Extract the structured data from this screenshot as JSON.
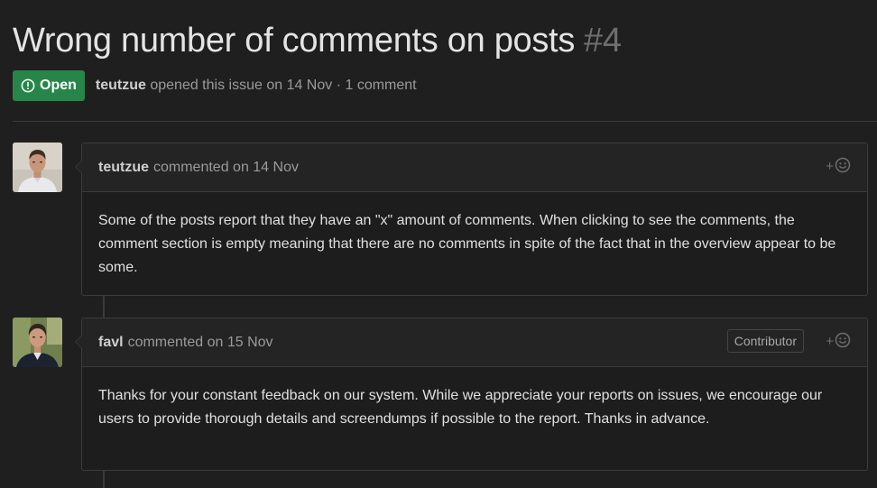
{
  "issue": {
    "title": "Wrong number of comments on posts",
    "number": "#4",
    "state": "Open",
    "author": "teutzue",
    "meta": "opened this issue on 14 Nov · 1 comment"
  },
  "comments": [
    {
      "author": "teutzue",
      "action": "commented on 14 Nov",
      "role_badge": "",
      "body": "Some of the posts report that they have an \"x\" amount of comments. When clicking to see the comments, the comment section is empty meaning that there are no comments in spite of the fact that in the overview appear to be some."
    },
    {
      "author": "favl",
      "action": "commented on 15 Nov",
      "role_badge": "Contributor",
      "body": "Thanks for your constant feedback on our system. While we appreciate your reports on issues, we encourage our users to provide thorough details and screendumps if possible to the report. Thanks in advance."
    }
  ],
  "icons": {
    "state": "issue-opened-icon",
    "reaction": "smiley-add-reaction-icon"
  },
  "colors": {
    "open_badge": "#27854a",
    "background": "#1f1f1f",
    "header_background": "#242424",
    "border": "#3c3c3c"
  }
}
